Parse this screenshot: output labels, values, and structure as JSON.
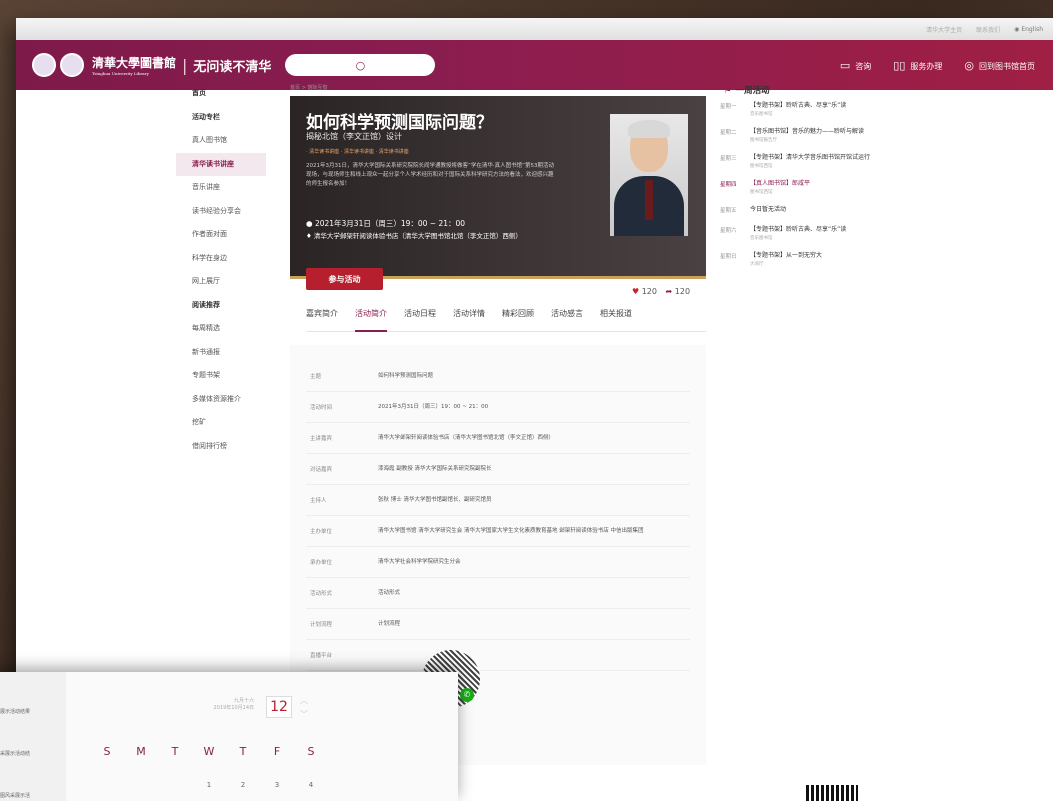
{
  "topbar": {
    "links": [
      "清华大学主页",
      "联系我们"
    ],
    "lang": "English"
  },
  "header": {
    "logo_text": "清華大學圖書館",
    "logo_sub": "Tsinghua University Library",
    "slogan": "无问读不清华",
    "nav": [
      {
        "icon": "chat-icon",
        "label": "咨询"
      },
      {
        "icon": "book-icon",
        "label": "服务办理"
      },
      {
        "icon": "user-icon",
        "label": "回到图书馆首页"
      }
    ]
  },
  "sidebar": {
    "items": [
      {
        "label": "首页",
        "style": "bold"
      },
      {
        "label": "活动专栏",
        "style": "bold"
      },
      {
        "label": "真人图书馆",
        "style": "normal"
      },
      {
        "label": "清华读书讲座",
        "style": "active"
      },
      {
        "label": "音乐讲座",
        "style": "normal"
      },
      {
        "label": "读书经验分享会",
        "style": "normal"
      },
      {
        "label": "作者面对面",
        "style": "normal"
      },
      {
        "label": "科学在身边",
        "style": "normal"
      },
      {
        "label": "网上展厅",
        "style": "normal"
      },
      {
        "label": "阅读推荐",
        "style": "bold"
      },
      {
        "label": "每周精选",
        "style": "normal"
      },
      {
        "label": "新书通报",
        "style": "normal"
      },
      {
        "label": "专题书架",
        "style": "normal"
      },
      {
        "label": "多媒体资源推介",
        "style": "normal"
      },
      {
        "label": "挖矿",
        "style": "normal"
      },
      {
        "label": "借阅排行榜",
        "style": "normal"
      }
    ]
  },
  "breadcrumb": "首页 > 馆际互借",
  "event": {
    "title": "如何科学预测国际问题？",
    "subtitle": "揭秘北馆（李文正馆）设计",
    "tags": "· 清华读书讲座  · 清华读书讲座  · 清华读书讲座",
    "desc": "2021年3月31日，清华大学国际关系研究院院长阎学通教授将做客“学在清华·真人图书馆”第53期活动现场，与现场师生和线上观众一起分享个人学术经历和对于国际关系科学研究方法的看法，欢迎感兴趣的师生报名参加！",
    "time": "2021年3月31日（周三）19：00 ~ 21：00",
    "place": "清华大学邺架轩阅读体验书店（清华大学图书馆北馆（李文正馆）西侧）",
    "join_label": "参与活动",
    "likes": "120",
    "shares": "120"
  },
  "tabs": [
    "嘉宾简介",
    "活动简介",
    "活动日程",
    "活动详情",
    "精彩回顾",
    "活动感言",
    "相关报道"
  ],
  "active_tab": 1,
  "details": [
    {
      "k": "主题",
      "v": "如何科学预测国际问题"
    },
    {
      "k": "活动时间",
      "v": "2021年3月31日（周三）19：00 ~ 21：00"
    },
    {
      "k": "主讲嘉宾",
      "v": "清华大学邺架轩阅读体验书店（清华大学图书馆北馆（李文正馆）西侧）"
    },
    {
      "k": "对话嘉宾",
      "v": "漆海霞 副教授 清华大学国际关系研究院副院长"
    },
    {
      "k": "主持人",
      "v": "张秋 博士 清华大学图书馆副馆长、副研究馆员"
    },
    {
      "k": "主办单位",
      "v": "清华大学图书馆 清华大学研究生会 清华大学国家大学生文化素质教育基地 邺架轩阅读体验书店 中信出版集团"
    },
    {
      "k": "承办单位",
      "v": "清华大学社会科学学院研究生分会"
    },
    {
      "k": "活动形式",
      "v": "活动形式"
    },
    {
      "k": "计划流程",
      "v": "计划流程"
    },
    {
      "k": "直播平台",
      "v": ""
    }
  ],
  "week": {
    "title": "一周活动",
    "items": [
      {
        "day": "星期一",
        "title": "【专题书架】聆听古典、尽享“乐”读",
        "sub": "音乐图书馆"
      },
      {
        "day": "星期二",
        "title": "【音乐图书馆】音乐的魅力——聆听与解读",
        "sub": "图书馆报告厅"
      },
      {
        "day": "星期三",
        "title": "【专题书架】清华大学音乐图书馆开馆试运行",
        "sub": "图书馆西馆"
      },
      {
        "day": "星期四",
        "title": "【真人图书馆】郎咸平",
        "sub": "图书馆西馆",
        "current": true
      },
      {
        "day": "星期五",
        "title": "今日暂无活动",
        "sub": ""
      },
      {
        "day": "星期六",
        "title": "【专题书架】聆听古典、尽享“乐”读",
        "sub": "音乐图书馆"
      },
      {
        "day": "星期日",
        "title": "【专题书架】从一到无穷大",
        "sub": "大阅厅"
      }
    ]
  },
  "calendar": {
    "side": [
      "展示活动结果",
      "采展示活动结",
      "图风采展示活"
    ],
    "lunar": "九月十六",
    "date": "2019年10月14日",
    "day": "12",
    "weekdays": [
      "S",
      "M",
      "T",
      "W",
      "T",
      "F",
      "S"
    ],
    "nums": [
      "",
      "",
      "",
      "1",
      "2",
      "3",
      "4"
    ]
  }
}
